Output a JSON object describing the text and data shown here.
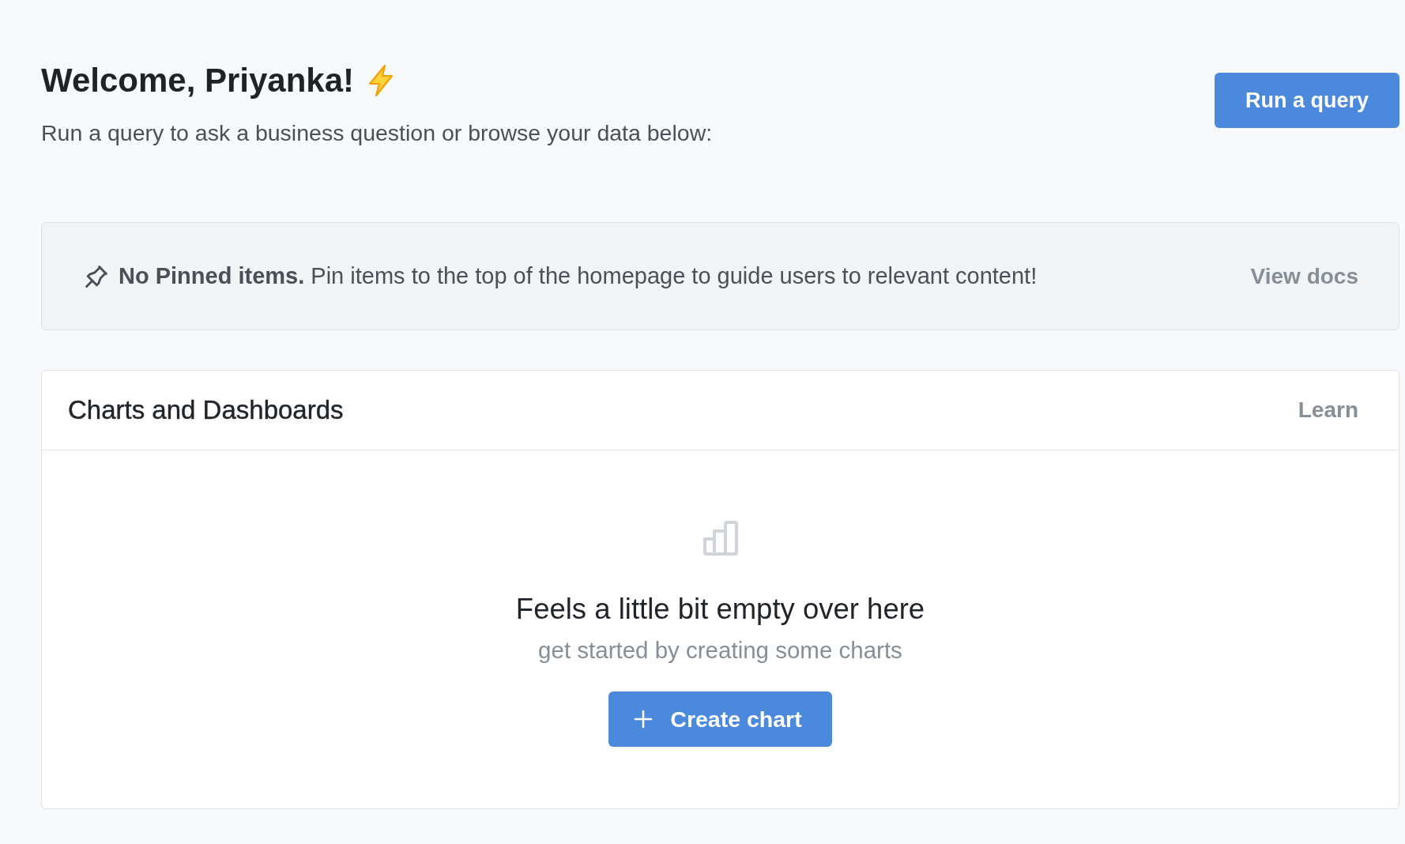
{
  "header": {
    "title": "Welcome, Priyanka!",
    "subtitle": "Run a query to ask a business question or browse your data below:",
    "action": "Run a query"
  },
  "pinned_banner": {
    "message": "**No Pinned items.** Pin items to the top of the homepage to guide users to relevant content!",
    "link": "View docs"
  },
  "charts_panel": {
    "title": "Charts and Dashboards",
    "link": "Learn",
    "empty_state": {
      "heading": "Feels a little bit empty over here",
      "description": "get started by creating some charts",
      "button": "Create chart"
    }
  }
}
